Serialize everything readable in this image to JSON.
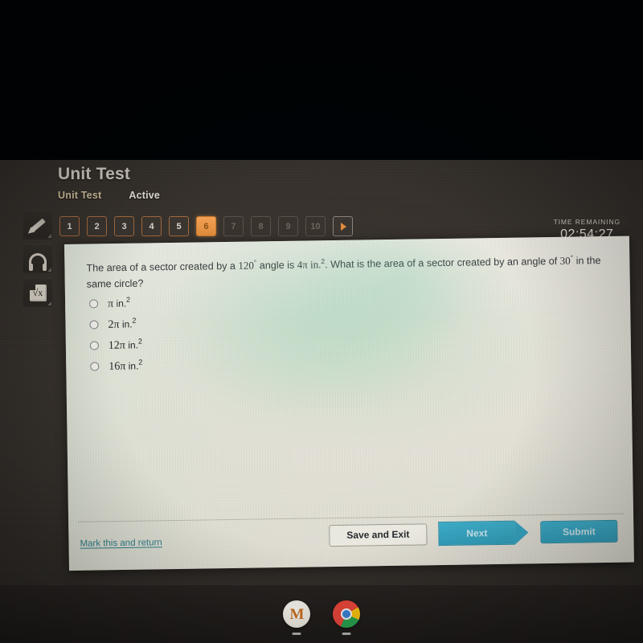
{
  "header": {
    "title": "Unit Test",
    "tabs": [
      {
        "label": "Unit Test",
        "state": "selected"
      },
      {
        "label": "Active",
        "state": "normal"
      }
    ]
  },
  "timer": {
    "label": "TIME REMAINING",
    "value": "02:54:27"
  },
  "question_nav": {
    "items": [
      {
        "label": "1",
        "state": "visited"
      },
      {
        "label": "2",
        "state": "visited"
      },
      {
        "label": "3",
        "state": "visited"
      },
      {
        "label": "4",
        "state": "visited"
      },
      {
        "label": "5",
        "state": "visited"
      },
      {
        "label": "6",
        "state": "current"
      },
      {
        "label": "7",
        "state": "disabled"
      },
      {
        "label": "8",
        "state": "disabled"
      },
      {
        "label": "9",
        "state": "disabled"
      },
      {
        "label": "10",
        "state": "disabled"
      }
    ],
    "next_arrow": "play-forward"
  },
  "tool_rail": {
    "items": [
      {
        "icon": "pencil-icon",
        "label": "Highlighter"
      },
      {
        "icon": "headphones-icon",
        "label": "Read aloud"
      },
      {
        "icon": "calculator-icon",
        "label": "Calculator"
      }
    ]
  },
  "question": {
    "part1": "The area of a sector created by a ",
    "angle1": "120",
    "degree": "°",
    "part2": " angle is ",
    "value": "4π in.",
    "sup": "2",
    "part3": ". What is the area of a sector created by an angle of ",
    "angle2": "30",
    "part4": " in the same circle?",
    "options": [
      {
        "coefficient": "",
        "symbol": "π",
        "unit": " in.",
        "exponent": "2",
        "selected": false
      },
      {
        "coefficient": "2",
        "symbol": "π",
        "unit": " in.",
        "exponent": "2",
        "selected": false
      },
      {
        "coefficient": "12",
        "symbol": "π",
        "unit": " in.",
        "exponent": "2",
        "selected": false
      },
      {
        "coefficient": "16",
        "symbol": "π",
        "unit": " in.",
        "exponent": "2",
        "selected": false
      }
    ]
  },
  "footer": {
    "mark_link": "Mark this and return",
    "save_exit": "Save and Exit",
    "next": "Next",
    "submit": "Submit"
  },
  "taskbar": {
    "items": [
      {
        "icon": "m-logo-icon",
        "label": "M"
      },
      {
        "icon": "chrome-icon",
        "label": ""
      }
    ]
  },
  "colors": {
    "accent_orange": "#e08b3b",
    "accent_teal": "#2e9fbd",
    "link_teal": "#2c7f8c",
    "screen_bg": "#332e29",
    "panel_bg": "#e9e7dc"
  }
}
